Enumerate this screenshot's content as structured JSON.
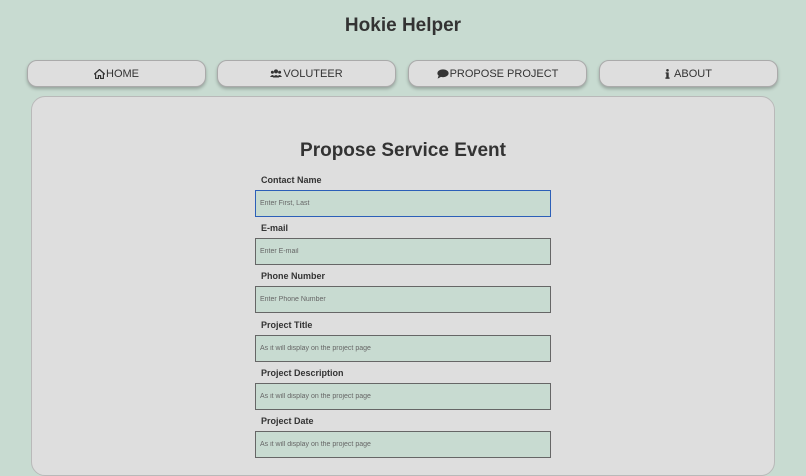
{
  "site": {
    "title": "Hokie Helper"
  },
  "nav": {
    "items": [
      {
        "label": "HOME",
        "icon": "home-icon"
      },
      {
        "label": "VOLUTEER",
        "icon": "users-icon"
      },
      {
        "label": "PROPOSE PROJECT",
        "icon": "comment-icon"
      },
      {
        "label": "ABOUT",
        "icon": "info-icon"
      }
    ]
  },
  "form": {
    "title": "Propose Service Event",
    "fields": [
      {
        "label": "Contact Name",
        "placeholder": "Enter First, Last",
        "value": ""
      },
      {
        "label": "E-mail",
        "placeholder": "Enter E-mail",
        "value": ""
      },
      {
        "label": "Phone Number",
        "placeholder": "Enter Phone Number",
        "value": ""
      },
      {
        "label": "Project Title",
        "placeholder": "As it will display on the project page",
        "value": ""
      },
      {
        "label": "Project Description",
        "placeholder": "As it will display on the project page",
        "value": ""
      },
      {
        "label": "Project Date",
        "placeholder": "As it will display on the project page",
        "value": ""
      }
    ]
  },
  "colors": {
    "background": "#c8dbd1",
    "panel": "#dedede",
    "focus_border": "#2c5fb8"
  }
}
